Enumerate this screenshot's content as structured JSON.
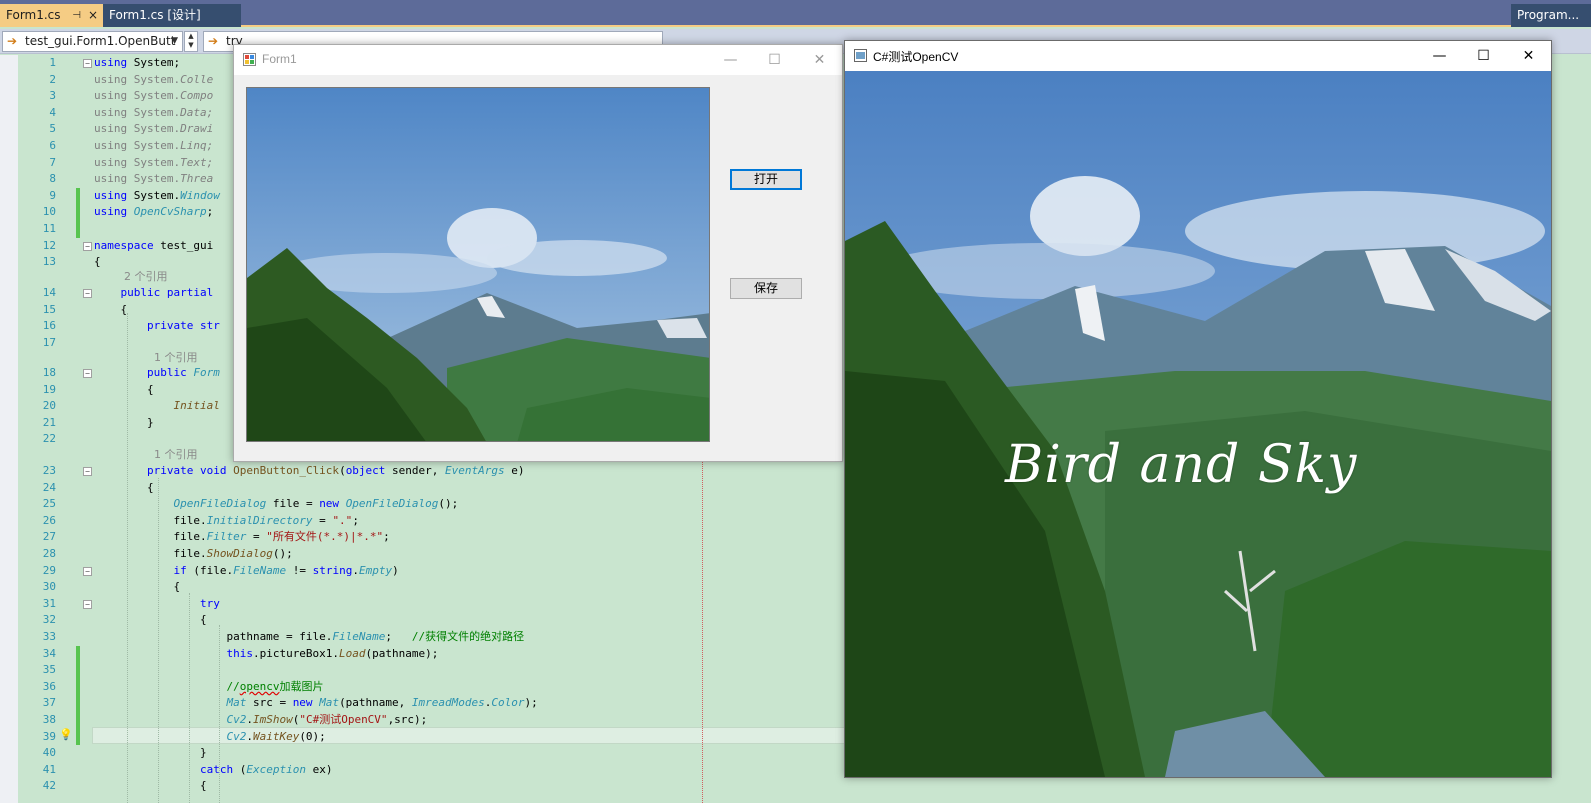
{
  "tabs": {
    "active_label": "Form1.cs",
    "active_pin": "⊣",
    "active_close": "×",
    "second_label": "Form1.cs [设计]",
    "right_label": "Program..."
  },
  "navbar": {
    "class_selector": "test_gui.Form1.OpenButt",
    "member_selector": "try"
  },
  "code": {
    "lines": [
      {
        "n": "1",
        "html": "<span class='kw'>using</span> System;"
      },
      {
        "n": "2",
        "html": "<span class='gr'>using System.</span><span class='gr' style='font-style:italic'>Colle</span>"
      },
      {
        "n": "3",
        "html": "<span class='gr'>using System.</span><span class='gr' style='font-style:italic'>Compo</span>"
      },
      {
        "n": "4",
        "html": "<span class='gr'>using System.</span><span class='gr' style='font-style:italic'>Data;</span>"
      },
      {
        "n": "5",
        "html": "<span class='gr'>using System.</span><span class='gr' style='font-style:italic'>Drawi</span>"
      },
      {
        "n": "6",
        "html": "<span class='gr'>using System.</span><span class='gr' style='font-style:italic'>Linq;</span>"
      },
      {
        "n": "7",
        "html": "<span class='gr'>using System.</span><span class='gr' style='font-style:italic'>Text;</span>"
      },
      {
        "n": "8",
        "html": "<span class='gr'>using System.</span><span class='gr' style='font-style:italic'>Threa</span>"
      },
      {
        "n": "9",
        "html": "<span class='kw'>using</span> System.<span class='ty'>Window</span>"
      },
      {
        "n": "10",
        "html": "<span class='kw'>using</span> <span class='ty'>OpenCvSharp</span>;"
      },
      {
        "n": "11",
        "html": ""
      },
      {
        "n": "12",
        "html": "<span class='kw'>namespace</span> test_gui"
      },
      {
        "n": "13",
        "html": "{"
      },
      {
        "n": "14",
        "html": "    <span class='kw'>public partial</span>"
      },
      {
        "n": "15",
        "html": "    {"
      },
      {
        "n": "16",
        "html": "        <span class='kw'>private str</span>"
      },
      {
        "n": "17",
        "html": ""
      },
      {
        "n": "18",
        "html": "        <span class='kw'>public</span> <span class='ty'>Form</span>"
      },
      {
        "n": "19",
        "html": "        {"
      },
      {
        "n": "20",
        "html": "            <span class='mt'>Initial</span>"
      },
      {
        "n": "21",
        "html": "        }"
      },
      {
        "n": "22",
        "html": ""
      },
      {
        "n": "23",
        "html": "        <span class='kw'>private void</span> <span style='color:#74531f'>OpenButton_Click</span>(<span class='kw'>object</span> sender, <span class='ty'>EventArgs</span> e)"
      },
      {
        "n": "24",
        "html": "        {"
      },
      {
        "n": "25",
        "html": "            <span class='ty'>OpenFileDialog</span> file = <span class='kw'>new</span> <span class='ty'>OpenFileDialog</span>();"
      },
      {
        "n": "26",
        "html": "            file.<span class='ty'>InitialDirectory</span> = <span class='st'>\".\"</span>;"
      },
      {
        "n": "27",
        "html": "            file.<span class='ty'>Filter</span> = <span class='st'>\"所有文件(*.*)|*.*\"</span>;"
      },
      {
        "n": "28",
        "html": "            file.<span class='mt'>ShowDialog</span>();"
      },
      {
        "n": "29",
        "html": "            <span class='kw'>if</span> (file.<span class='ty'>FileName</span> != <span class='kw'>string</span>.<span class='ty'>Empty</span>)"
      },
      {
        "n": "30",
        "html": "            {"
      },
      {
        "n": "31",
        "html": "                <span class='kw'>try</span>"
      },
      {
        "n": "32",
        "html": "                {"
      },
      {
        "n": "33",
        "html": "                    pathname = file.<span class='ty'>FileName</span>;   <span class='cm'>//获得文件的绝对路径</span>"
      },
      {
        "n": "34",
        "html": "                    <span class='kw'>this</span>.pictureBox1.<span class='mt'>Load</span>(pathname);"
      },
      {
        "n": "35",
        "html": ""
      },
      {
        "n": "36",
        "html": "                    <span class='cm'>//<span style='text-decoration:underline wavy #e00000'>opencv</span>加载图片</span>"
      },
      {
        "n": "37",
        "html": "                    <span class='ty'>Mat</span> src = <span class='kw'>new</span> <span class='ty'>Mat</span>(pathname, <span class='ty'>ImreadModes</span>.<span class='ty'>Color</span>);"
      },
      {
        "n": "38",
        "html": "                    <span class='ty'>Cv2</span>.<span class='mt'>ImShow</span>(<span class='st'>\"C#测试OpenCV\"</span>,src);"
      },
      {
        "n": "39",
        "html": "                    <span class='ty'>Cv2</span>.<span class='mt'>WaitKey</span>(0);"
      },
      {
        "n": "40",
        "html": "                }"
      },
      {
        "n": "41",
        "html": "                <span class='kw'>catch</span> (<span class='ty'>Exception</span> ex)"
      },
      {
        "n": "42",
        "html": "                {"
      }
    ],
    "ref_2": "2 个引用",
    "ref_1a": "1 个引用",
    "ref_1b": "1 个引用"
  },
  "form1": {
    "title": "Form1",
    "open_button": "打开",
    "save_button": "保存",
    "min": "—",
    "max": "☐",
    "close": "✕"
  },
  "cv_window": {
    "title": "C#测试OpenCV",
    "overlay_text": "Bird and Sky",
    "min": "—",
    "max": "☐",
    "close": "✕"
  }
}
